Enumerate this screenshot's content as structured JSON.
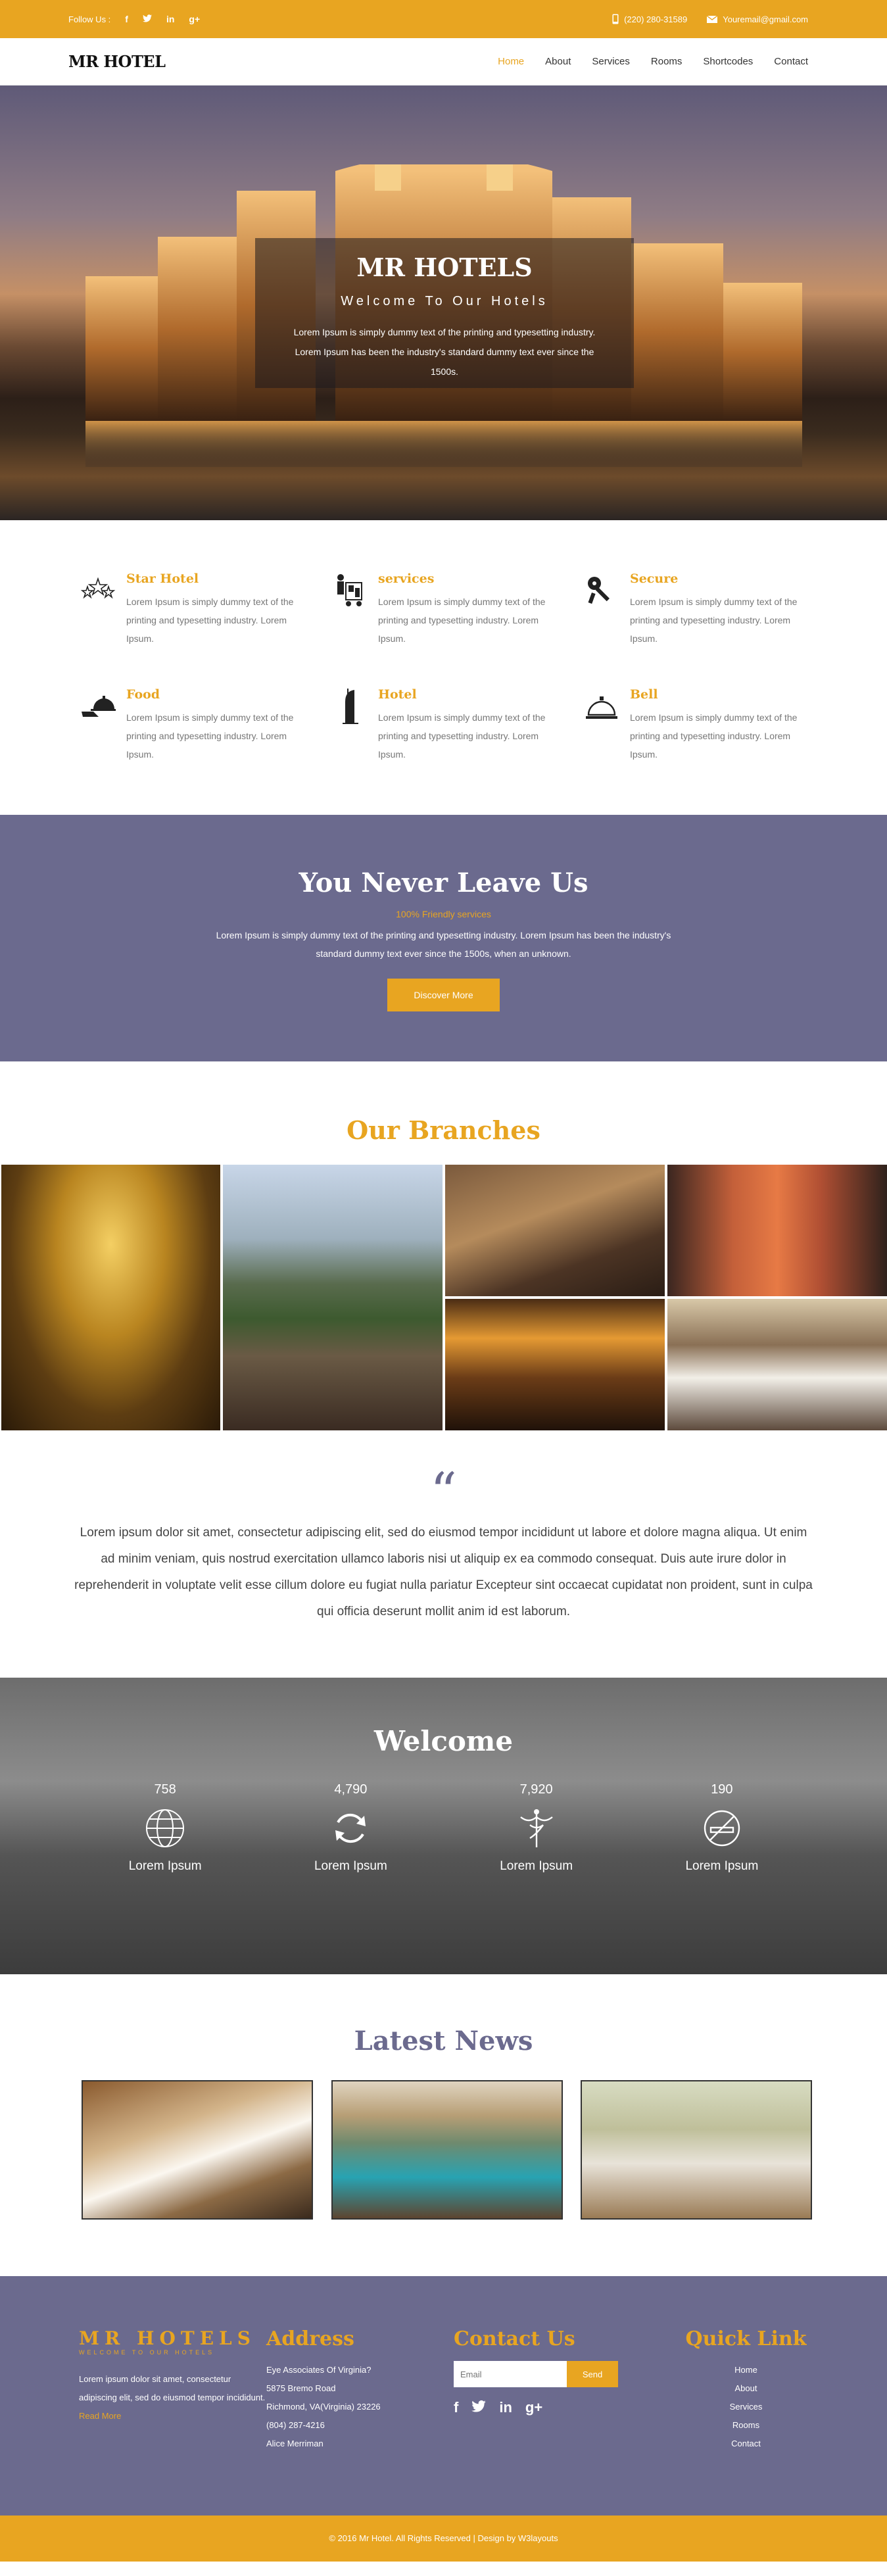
{
  "topbar": {
    "follow_label": "Follow Us :",
    "social": [
      "facebook-icon",
      "twitter-icon",
      "linkedin-icon",
      "google-plus-icon"
    ],
    "phone": "(220) 280-31589",
    "email": "Youremail@gmail.com"
  },
  "nav": {
    "logo": "MR HOTEL",
    "items": [
      "Home",
      "About",
      "Services",
      "Rooms",
      "Shortcodes",
      "Contact"
    ],
    "active": "Home"
  },
  "hero": {
    "title": "MR HOTELS",
    "subtitle": "Welcome To Our Hotels",
    "text": "Lorem Ipsum is simply dummy text of the printing and typesetting industry. Lorem Ipsum has been the industry's standard dummy text ever since the 1500s."
  },
  "features": [
    {
      "title": "Star Hotel",
      "icon": "stars-icon",
      "text": "Lorem Ipsum is simply dummy text of the printing and typesetting industry. Lorem Ipsum."
    },
    {
      "title": "services",
      "icon": "bellboy-cart-icon",
      "text": "Lorem Ipsum is simply dummy text of the printing and typesetting industry. Lorem Ipsum."
    },
    {
      "title": "Secure",
      "icon": "keys-icon",
      "text": "Lorem Ipsum is simply dummy text of the printing and typesetting industry. Lorem Ipsum."
    },
    {
      "title": "Food",
      "icon": "serving-tray-icon",
      "text": "Lorem Ipsum is simply dummy text of the printing and typesetting industry. Lorem Ipsum."
    },
    {
      "title": "Hotel",
      "icon": "tower-hotel-icon",
      "text": "Lorem Ipsum is simply dummy text of the printing and typesetting industry. Lorem Ipsum."
    },
    {
      "title": "Bell",
      "icon": "reception-bell-icon",
      "text": "Lorem Ipsum is simply dummy text of the printing and typesetting industry. Lorem Ipsum."
    }
  ],
  "never_leave": {
    "title": "You Never Leave Us",
    "subtitle": "100% Friendly services",
    "text": "Lorem Ipsum is simply dummy text of the printing and typesetting industry. Lorem Ipsum has been the industry's standard dummy text ever since the 1500s, when an unknown.",
    "button": "Discover More"
  },
  "branches": {
    "title": "Our Branches"
  },
  "quote": {
    "text": "Lorem ipsum dolor sit amet, consectetur adipiscing elit, sed do eiusmod tempor incididunt ut labore et dolore magna aliqua. Ut enim ad minim veniam, quis nostrud exercitation ullamco laboris nisi ut aliquip ex ea commodo consequat. Duis aute irure dolor in reprehenderit in voluptate velit esse cillum dolore eu fugiat nulla pariatur Excepteur sint occaecat cupidatat non proident, sunt in culpa qui officia deserunt mollit anim id est laborum."
  },
  "welcome": {
    "title": "Welcome",
    "stats": [
      {
        "value": "758",
        "label": "Lorem Ipsum",
        "icon": "globe-icon"
      },
      {
        "value": "4,790",
        "label": "Lorem Ipsum",
        "icon": "refresh-icon"
      },
      {
        "value": "7,920",
        "label": "Lorem Ipsum",
        "icon": "caduceus-icon"
      },
      {
        "value": "190",
        "label": "Lorem Ipsum",
        "icon": "no-smoking-icon"
      }
    ]
  },
  "news": {
    "title": "Latest News"
  },
  "footer": {
    "logo": "MR HOTELS",
    "tagline": "WELCOME TO OUR HOTELS",
    "about": "Lorem ipsum dolor sit amet, consectetur adipiscing elit, sed do eiusmod tempor incididunt.",
    "read_more": "Read More",
    "address_title": "Address",
    "address_lines": [
      "Eye Associates Of Virginia?",
      "5875 Bremo Road",
      "Richmond, VA(Virginia) 23226",
      "(804) 287-4216",
      "Alice Merriman"
    ],
    "contact_title": "Contact Us",
    "email_placeholder": "Email",
    "send_label": "Send",
    "quick_title": "Quick Link",
    "quick_links": [
      "Home",
      "About",
      "Services",
      "Rooms",
      "Contact"
    ]
  },
  "copyright": "© 2016 Mr Hotel. All Rights Reserved | Design by W3layouts",
  "colors": {
    "accent": "#e8a521",
    "purple": "#6b6a8e"
  }
}
